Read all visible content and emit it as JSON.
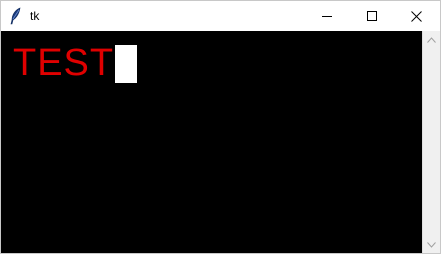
{
  "window": {
    "title": "tk"
  },
  "titlebar_buttons": {
    "minimize_icon": "minimize-icon",
    "maximize_icon": "maximize-icon",
    "close_icon": "close-icon"
  },
  "editor": {
    "text": "TEST",
    "text_color": "#e00000",
    "background_color": "#000000",
    "cursor_color": "#ffffff"
  },
  "scrollbar": {
    "up_icon": "chevron-up-icon",
    "down_icon": "chevron-down-icon"
  }
}
